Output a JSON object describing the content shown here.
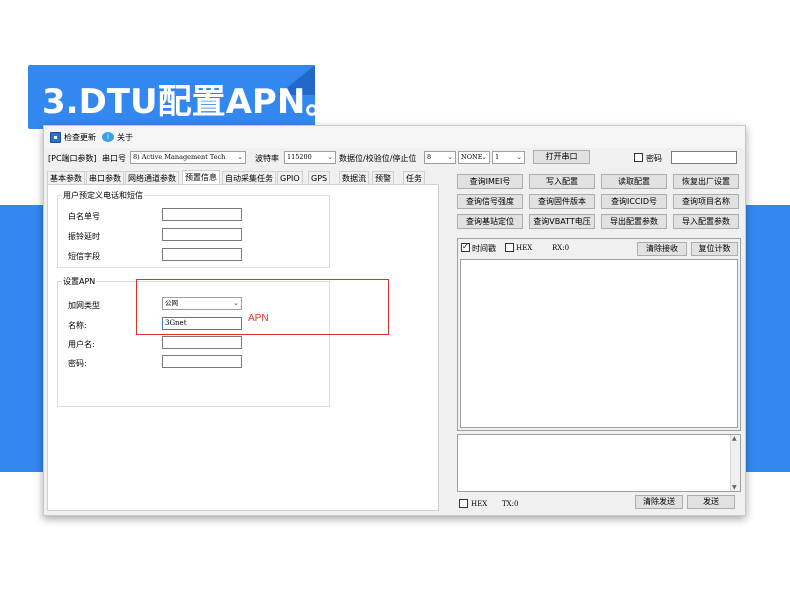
{
  "banner": {
    "title": "3.DTU配置APN。"
  },
  "toolbar": {
    "check_update": "检查更新",
    "about": "关于"
  },
  "serial": {
    "config_label": "[PC端口参数]",
    "port_label": "串口号",
    "port_value": "8) Active Management Tech",
    "baud_label": "波特率",
    "baud_value": "115200",
    "param_label": "数据位/校验位/停止位",
    "databits": "8",
    "parity": "NONE",
    "stopbits": "1",
    "open_button": "打开串口",
    "password_label": "密码"
  },
  "tabs": [
    "基本参数",
    "串口参数",
    "网络通道参数",
    "预置信息",
    "自动采集任务",
    "GPIO",
    "GPS",
    "数据流",
    "预警",
    "任务"
  ],
  "active_tab": "预置信息",
  "preset_group": {
    "title": "用户预定义电话和短信",
    "fields": [
      {
        "label": "白名单号",
        "value": ""
      },
      {
        "label": "振铃延时",
        "value": ""
      },
      {
        "label": "短信字段",
        "value": ""
      }
    ]
  },
  "apn_group": {
    "title": "设置APN",
    "network_type_label": "加网类型",
    "network_type_value": "公网",
    "name_label": "名称:",
    "name_value": "3Gnet",
    "user_label": "用户名:",
    "user_value": "",
    "password_label": "密码:",
    "password_value": "",
    "annotation": "APN"
  },
  "action_buttons": [
    [
      "查询IMEI号",
      "写入配置",
      "读取配置",
      "恢复出厂设置"
    ],
    [
      "查询信号强度",
      "查询固件版本",
      "查询ICCID号",
      "查询项目名称"
    ],
    [
      "查询基站定位",
      "查询VBATT电压",
      "导出配置参数",
      "导入配置参数"
    ]
  ],
  "rx": {
    "timestamp_label": "时间戳",
    "hex_label": "HEX",
    "rx_count": "RX:0",
    "clear_button": "清除接收",
    "reset_button": "复位计数"
  },
  "tx": {
    "hex_label": "HEX",
    "tx_count": "TX:0",
    "clear_button": "清除发送",
    "send_button": "发送"
  }
}
